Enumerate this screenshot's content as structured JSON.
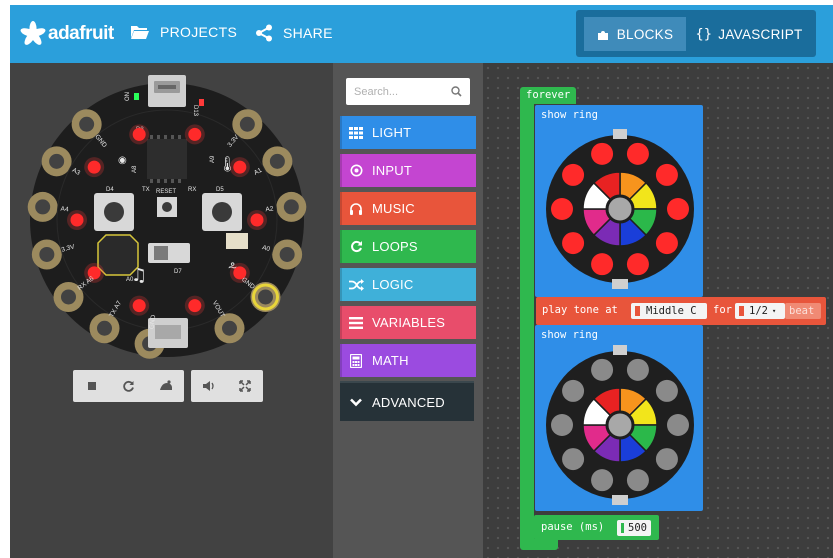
{
  "header": {
    "brand": "adafruit",
    "nav": [
      {
        "label": "PROJECTS",
        "icon": "folder-open-icon"
      },
      {
        "label": "SHARE",
        "icon": "share-icon"
      }
    ],
    "modes": [
      {
        "label": "BLOCKS",
        "icon": "puzzle-piece-icon",
        "active": true
      },
      {
        "label": "JAVASCRIPT",
        "icon": "code-braces-icon",
        "active": false
      }
    ]
  },
  "board": {
    "pins": [
      "GND",
      "A3",
      "A4",
      "3.3V",
      "RX A6",
      "TX A7",
      "GND",
      "3.3V",
      "A1",
      "A2",
      "A0",
      "GND",
      "VOUT"
    ],
    "labels": {
      "usb": "USB",
      "d13": "D13",
      "on": "ON",
      "d8": "D8",
      "d4": "D4",
      "d5": "D5",
      "tx": "TX",
      "rx": "RX",
      "reset": "RESET",
      "d7": "D7",
      "a8": "A8",
      "a9": "A9",
      "a0": "A0"
    }
  },
  "sim_controls": [
    "stop-icon",
    "restart-icon",
    "slow-motion-icon",
    "mute-icon",
    "fullscreen-icon"
  ],
  "toolbox": {
    "search_placeholder": "Search...",
    "categories": [
      {
        "label": "LIGHT",
        "icon": "grid-icon",
        "color": "#2f8ee8"
      },
      {
        "label": "INPUT",
        "icon": "target-icon",
        "color": "#c445d1"
      },
      {
        "label": "MUSIC",
        "icon": "headphones-icon",
        "color": "#e8553b"
      },
      {
        "label": "LOOPS",
        "icon": "refresh-icon",
        "color": "#2fb84e"
      },
      {
        "label": "LOGIC",
        "icon": "shuffle-icon",
        "color": "#3fb0d9"
      },
      {
        "label": "VARIABLES",
        "icon": "list-icon",
        "color": "#e84d6b"
      },
      {
        "label": "MATH",
        "icon": "calculator-icon",
        "color": "#9b4be0"
      }
    ],
    "advanced": "ADVANCED"
  },
  "blocks": {
    "forever": "forever",
    "show_ring_1": "show ring",
    "show_ring_2": "show ring",
    "play_tone": "play tone at",
    "note": "Middle C",
    "for": "for",
    "duration": "1/2",
    "beat": "beat",
    "pause": "pause (ms)",
    "pause_value": "500"
  },
  "colors": {
    "header": "#2b9fdb",
    "light_block": "#2f8ee8",
    "loop_block": "#2fb84e",
    "music_block": "#e8553b",
    "led_red": "#ff2a2a",
    "led_off": "#8a8a8a"
  }
}
